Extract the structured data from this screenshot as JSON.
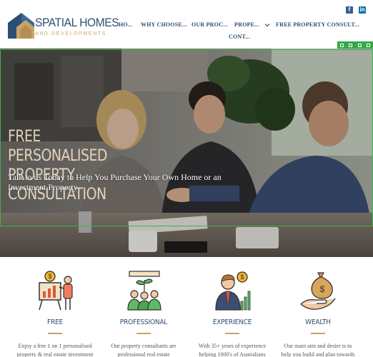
{
  "brand": {
    "name": "SPATIAL HOMES",
    "tagline": "AND DEVELOPMENTS",
    "colors": {
      "navy": "#2c4f74",
      "gold": "#c8a46a"
    }
  },
  "social": {
    "facebook_icon": "f",
    "linkedin_icon": "in"
  },
  "nav": {
    "items": [
      {
        "label": "HO..."
      },
      {
        "label": "WHY CHOOSE..."
      },
      {
        "label": "OUR PROC..."
      },
      {
        "label": "PROPE..."
      },
      {
        "label": "FREE PROPERTY CONSULT..."
      },
      {
        "label": "CONT..."
      }
    ]
  },
  "hero": {
    "title": "FREE PERSONALISED PROPERTY CONSULTATION",
    "subtitle": "Talk to us Today to Help You Purchase Your Own Home or an Investment Property"
  },
  "features": [
    {
      "title": "FREE",
      "icon": "presentation-icon",
      "desc": "Enjoy a free 1 on 1 personalised property & real estate investment"
    },
    {
      "title": "PROFESSIONAL",
      "icon": "team-growth-icon",
      "desc": "Our property consultants are professional real estate"
    },
    {
      "title": "EXPERIENCE",
      "icon": "businessman-icon",
      "desc": "With 35+ years of experience helping 1000's of Australians"
    },
    {
      "title": "WEALTH",
      "icon": "money-bag-hand-icon",
      "desc": "Our main aim and desire is to help you build and plan towards"
    }
  ]
}
